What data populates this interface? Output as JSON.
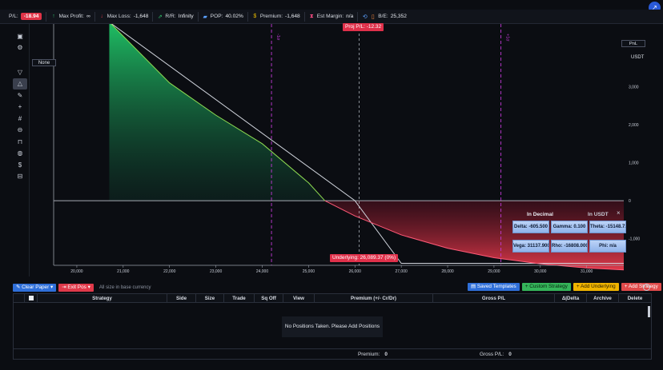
{
  "topbar": {
    "pl_label": "P/L:",
    "pl_value": "-18.94",
    "max_profit_label": "Max Profit:",
    "max_profit_value": "∞",
    "max_loss_label": "Max Loss:",
    "max_loss_value": "-1,648",
    "rr_label": "R/R:",
    "rr_value": "Infinity",
    "pop_label": "POP:",
    "pop_value": "40.02%",
    "premium_label": "Premium:",
    "premium_value": "-1,648",
    "est_margin_label": "Est Margin:",
    "est_margin_value": "n/a",
    "be_label": "B/E:",
    "be_value": "25,352"
  },
  "left_toolbar": {
    "icons": [
      "layout-icon",
      "settings-icon",
      "filter-icon",
      "shape-icon",
      "pencil-icon",
      "crosshair-icon",
      "grid-icon",
      "zoom-icon",
      "lock-icon",
      "globe-icon",
      "dollar-icon",
      "trash-icon"
    ],
    "active_index": 3
  },
  "chart": {
    "none_button": "None",
    "legend_label": "PnL",
    "unit_label": "USDT",
    "proj_badge": "Proj P/L: -12.32",
    "underlying_badge": "Underlying: 26,089.37 (0%)",
    "x_ticks": [
      "20,000",
      "21,000",
      "22,000",
      "23,000",
      "24,000",
      "25,000",
      "26,000",
      "27,000",
      "28,000",
      "29,000",
      "30,000",
      "31,000"
    ],
    "y_ticks": [
      "3,000",
      "2,000",
      "1,000",
      "0",
      "-1,000"
    ],
    "vline_labels": [
      "-1σ",
      "+1σ"
    ],
    "colors": {
      "profit": "#1fbf64",
      "loss": "#e0394a",
      "expiry_line": "#d0d4dc",
      "today_line": "#8fdc52",
      "sigma_line": "#c13ad6"
    }
  },
  "chart_data": {
    "type": "area",
    "title": "",
    "xlabel": "",
    "ylabel": "USDT",
    "xlim": [
      19500,
      31800
    ],
    "ylim": [
      -1700,
      4650
    ],
    "series": [
      {
        "name": "",
        "x": [
          20700,
          26000,
          27000,
          31800
        ],
        "y": [
          4700,
          0,
          -1648,
          -1648
        ]
      },
      {
        "name": "",
        "x": [
          20700,
          22000,
          23000,
          24000,
          25000,
          25352,
          26000,
          27000,
          28000,
          29000,
          30000,
          31000,
          31800
        ],
        "y": [
          4700,
          3100,
          2250,
          1500,
          470,
          0,
          -400,
          -900,
          -1250,
          -1500,
          -1660,
          -1770,
          -1820
        ]
      }
    ],
    "sigma_lines_x": [
      24200,
      29150
    ],
    "underlying_x": 26089.37
  },
  "greeks": {
    "title": "In Decimal",
    "unit": "In USDT",
    "close": "×",
    "delta": "Delta: -605.500",
    "gamma": "Gamma: 0.100",
    "theta": "Theta: -15148.72",
    "vega": "Vega: 31137.900",
    "rho": "Rho: -16808.000",
    "phi": "Phi: n/a"
  },
  "bottom_toolbar": {
    "clear_paper": "Clear Paper",
    "exit_pos": "Exit Pos",
    "hint": "All size in base currency",
    "saved_templates": "Saved Templates",
    "custom_strategy": "Custom Strategy",
    "add_underlying": "Add Underlying",
    "add_strategy": "Add Strategy"
  },
  "table": {
    "headers": [
      "",
      "Strategy",
      "Side",
      "Size",
      "Trade",
      "Sq Off",
      "View",
      "Premium (+/- Cr/Dr)",
      "Gross P/L",
      "Δ|Delta",
      "Archive",
      "Delete"
    ],
    "empty_message": "No Positions Taken. Please Add Positions"
  },
  "footer": {
    "premium_label": "Premium:",
    "premium_value": "0",
    "gross_label": "Gross P/L:",
    "gross_value": "0"
  }
}
